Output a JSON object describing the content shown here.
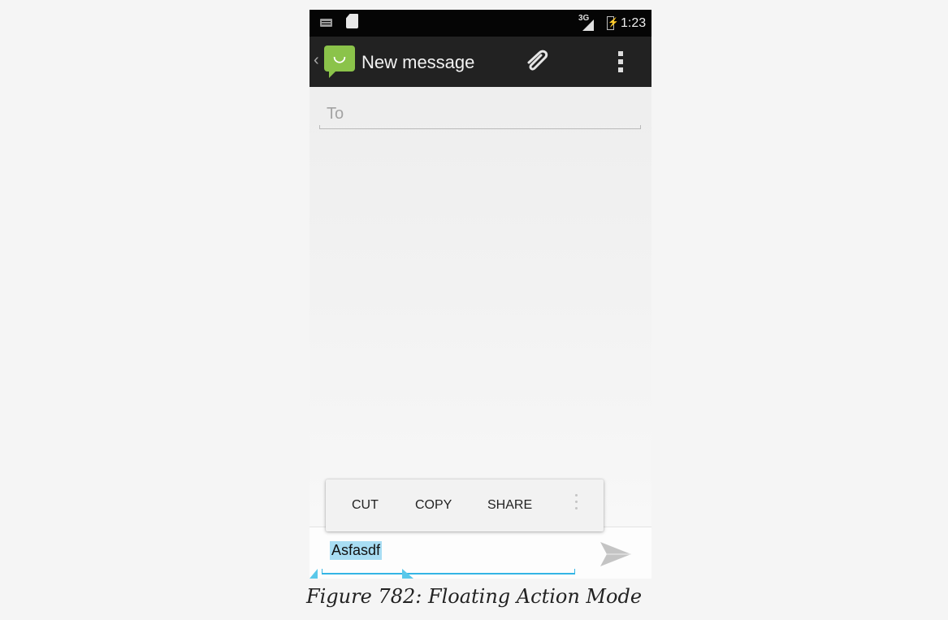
{
  "status_bar": {
    "network": "3G",
    "time": "1:23",
    "icons": [
      "keyboard-icon",
      "sd-card-icon",
      "signal-icon",
      "battery-charging-icon"
    ]
  },
  "action_bar": {
    "title": "New message",
    "app_icon": "messaging-smiley-icon",
    "actions": [
      "attach-icon",
      "overflow-menu-icon"
    ]
  },
  "recipients": {
    "placeholder": "To"
  },
  "floating_toolbar": {
    "items": [
      "CUT",
      "COPY",
      "SHARE"
    ],
    "overflow_icon": "more-vertical-icon"
  },
  "compose": {
    "text": "Asfasdf",
    "selection_color": "#a8ddf3",
    "accent": "#33b5e5",
    "send_icon": "send-icon"
  },
  "caption": "Figure 782: Floating Action Mode"
}
